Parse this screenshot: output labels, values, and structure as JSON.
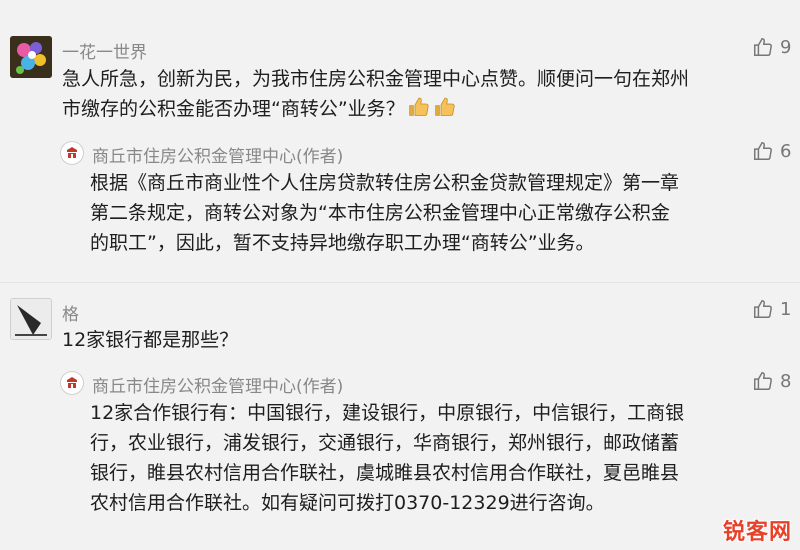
{
  "comments": [
    {
      "user": "一花一世界",
      "avatar_icon": "flower-avatar-icon",
      "likes": "9",
      "lines": [
        "急人所急，创新为民，为我市住房公积金管理中心点赞。顺便问一句在郑州",
        "市缴存的公积金能否办理“商转公”业务？"
      ],
      "reply": {
        "author": "商丘市住房公积金管理中心(作者)",
        "likes": "6",
        "lines": [
          "根据《商丘市商业性个人住房贷款转住房公积金贷款管理规定》第一章",
          "第二条规定，商转公对象为“本市住房公积金管理中心正常缴存公积金",
          "的职工”，因此，暂不支持异地缴存职工办理“商转公”业务。"
        ]
      }
    },
    {
      "user": "格",
      "avatar_icon": "sketch-avatar-icon",
      "likes": "1",
      "lines": [
        "12家银行都是那些？"
      ],
      "reply": {
        "author": "商丘市住房公积金管理中心(作者)",
        "likes": "8",
        "lines": [
          "12家合作银行有：中国银行，建设银行，中原银行，中信银行，工商银",
          "行，农业银行，浦发银行，交通银行，华商银行，郑州银行，邮政储蓄",
          "银行，睢县农村信用合作联社，虞城睢县农村信用合作联社，夏邑睢县",
          "农村信用合作联社。如有疑问可拨打0370-12329进行咨询。"
        ]
      }
    }
  ],
  "watermark": "锐客网",
  "colors": {
    "like_gray": "#777777",
    "name_gray": "#888888",
    "watermark_red": "#e8412a"
  }
}
